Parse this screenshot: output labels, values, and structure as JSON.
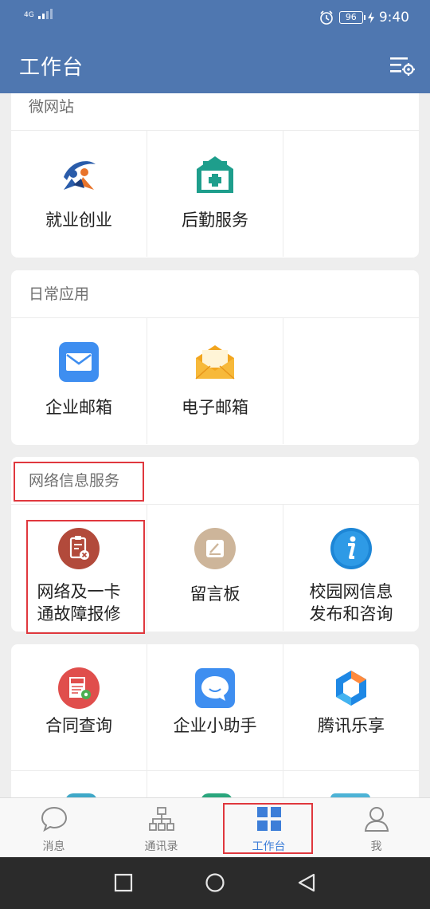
{
  "status_bar": {
    "network": "4G",
    "battery": "96",
    "time": "9:40"
  },
  "app_bar": {
    "title": "工作台",
    "settings_icon": "list-settings-icon"
  },
  "sections": [
    {
      "title": "微网站",
      "items": [
        {
          "label": "就业创业",
          "icon": "employment-icon"
        },
        {
          "label": "后勤服务",
          "icon": "logistics-icon"
        }
      ]
    },
    {
      "title": "日常应用",
      "items": [
        {
          "label": "企业邮箱",
          "icon": "mail-icon"
        },
        {
          "label": "电子邮箱",
          "icon": "envelope-icon"
        }
      ]
    },
    {
      "title": "网络信息服务",
      "items": [
        {
          "label": "网络及一卡\n通故障报修",
          "icon": "repair-icon"
        },
        {
          "label": "留言板",
          "icon": "message-board-icon"
        },
        {
          "label": "校园网信息\n发布和咨询",
          "icon": "info-icon"
        }
      ]
    },
    {
      "title": "",
      "items": [
        {
          "label": "合同查询",
          "icon": "contract-icon"
        },
        {
          "label": "企业小助手",
          "icon": "chat-bubble-icon"
        },
        {
          "label": "腾讯乐享",
          "icon": "lexiang-icon"
        }
      ]
    }
  ],
  "tabs": [
    {
      "label": "消息",
      "icon": "message-icon",
      "active": false
    },
    {
      "label": "通讯录",
      "icon": "contacts-icon",
      "active": false
    },
    {
      "label": "工作台",
      "icon": "workbench-icon",
      "active": true
    },
    {
      "label": "我",
      "icon": "person-icon",
      "active": false
    }
  ],
  "colors": {
    "header": "#4f77b0",
    "active_tab": "#3d7ed8",
    "highlight": "#e0383e"
  }
}
